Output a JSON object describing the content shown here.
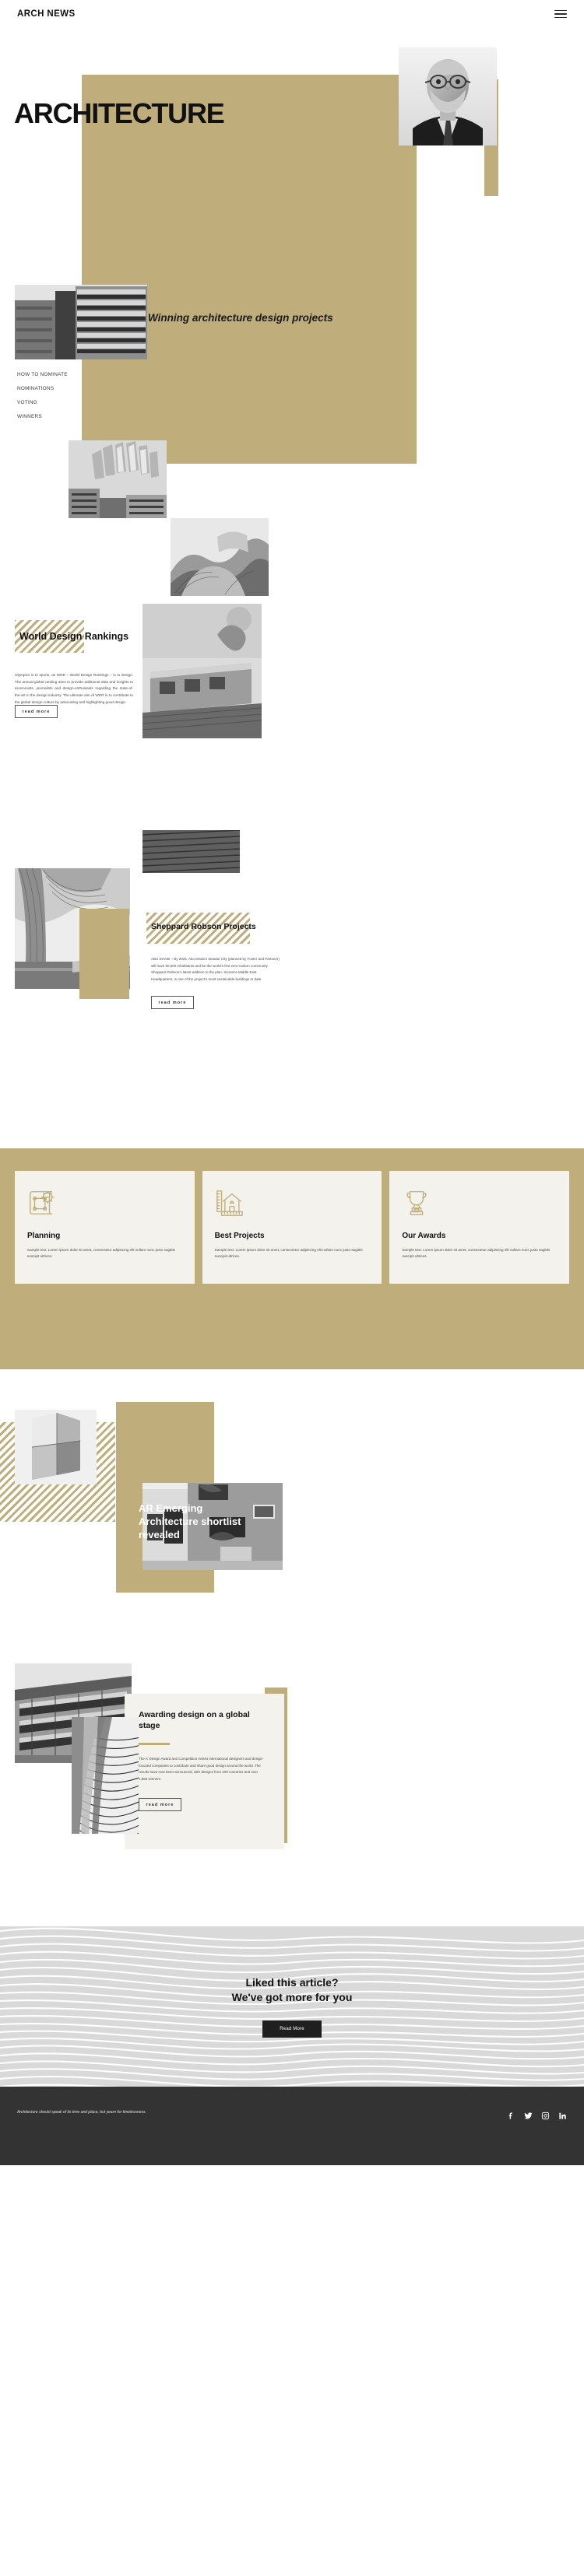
{
  "header": {
    "logo": "ARCH NEWS",
    "menu_icon": "hamburger-icon"
  },
  "hero": {
    "title": "ARCHITECTURE",
    "portrait_alt": "architect-portrait"
  },
  "intro": {
    "subtitle": "Winning architecture design projects",
    "nav": [
      {
        "label": "HOW TO NOMINATE"
      },
      {
        "label": "NOMINATIONS"
      },
      {
        "label": "VOTING"
      },
      {
        "label": "WINNERS"
      }
    ]
  },
  "world_design_rankings": {
    "heading": "World Design Rankings",
    "body": "Olympics is to sports, as WDR – World Design Rankings – is to design. The annual global ranking aims to provide additional data and insights to economists, journalists and design-enthusiasts regarding the state-of-the-art in the design industry. The ultimate aim of WDR is to contribute to the global design culture by advocating and highlighting good design.",
    "button": "read more"
  },
  "sheppard": {
    "heading": "Sheppard Robson Projects",
    "body": "ABU DHABI – By 2025, Abu Dhabi’s Masdar City (planned by Foster and Partners) will have 50,000 inhabitants and be the world’s first zero-carbon community. Sheppard Robson’s latest addition to the plan, Siemens Middle East Headquarters, is one of the project’s most sustainable buildings to date",
    "button": "read more"
  },
  "cards": [
    {
      "icon": "blueprint-icon",
      "title": "Planning",
      "text": "Sample text. Lorem ipsum dolor sit amet, consectetur adipiscing elit nullam nunc justo sagittis suscipit ultrices."
    },
    {
      "icon": "house-ruler-icon",
      "title": "Best Projects",
      "text": "Sample text. Lorem ipsum dolor sit amet, consectetur adipiscing elit nullam nunc justo sagittis suscipit ultrices."
    },
    {
      "icon": "trophy-icon",
      "title": "Our Awards",
      "text": "Sample text. Lorem ipsum dolor sit amet, consectetur adipiscing elit nullam nunc justo sagittis suscipit ultrices."
    }
  ],
  "ar_emerging": {
    "title": "AR Emerging Architecture shortlist revealed"
  },
  "awarding": {
    "heading": "Awarding design on a global stage",
    "body": "The A’ Design Award and Competition invites international designers and design-focused companies to contribute and share good design around the world. The results have now been announced, with designs from 100 countries and over 1,960 winners.",
    "button": "read more"
  },
  "cta": {
    "line1": "Liked this article?",
    "line2": "We've got more for you",
    "button": "Read More"
  },
  "footer": {
    "quote": "Architecture should speak of its time and place, but yearn for timelessness.",
    "socials": [
      {
        "name": "facebook-icon"
      },
      {
        "name": "twitter-icon"
      },
      {
        "name": "instagram-icon"
      },
      {
        "name": "linkedin-icon"
      }
    ]
  },
  "colors": {
    "khaki": "#bfae7c",
    "cream": "#f4f2ec",
    "dark": "#333333",
    "text": "#1c1c1c"
  }
}
